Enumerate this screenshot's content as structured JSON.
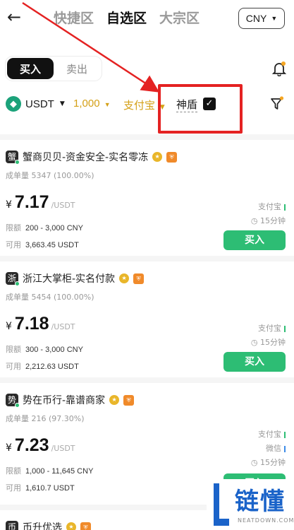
{
  "header": {
    "back_icon": "arrow-left-icon",
    "tabs": [
      {
        "label": "快捷区",
        "active": false
      },
      {
        "label": "自选区",
        "active": true
      },
      {
        "label": "大宗区",
        "active": false
      }
    ],
    "currency": "CNY"
  },
  "trade_toggle": {
    "buy": "买入",
    "sell": "出",
    "sell_prefix": "卖"
  },
  "filters": {
    "coin": "USDT",
    "amount": "1,000",
    "payment": "支付宝",
    "shield_label": "神盾",
    "shield_checked": true
  },
  "listings": [
    {
      "avatar": "蟹",
      "name": "蟹商贝贝-资金安全-实名零冻",
      "stats_label": "成单量",
      "stats": "5347 (100.00%)",
      "currency_symbol": "¥",
      "price": "7.17",
      "unit": "/USDT",
      "limit_label": "限额",
      "limit": "200 - 3,000 CNY",
      "avail_label": "可用",
      "available": "3,663.45 USDT",
      "payments": [
        "支付宝"
      ],
      "time": "15分钟",
      "action": "买入"
    },
    {
      "avatar": "浙",
      "name": "浙江大掌柜-实名付款",
      "stats_label": "成单量",
      "stats": "5454 (100.00%)",
      "currency_symbol": "¥",
      "price": "7.18",
      "unit": "/USDT",
      "limit_label": "限额",
      "limit": "300 - 3,000 CNY",
      "avail_label": "可用",
      "available": "2,212.63 USDT",
      "payments": [
        "支付宝"
      ],
      "time": "15分钟",
      "action": "买入"
    },
    {
      "avatar": "势",
      "name": "势在币行-靠谱商家",
      "stats_label": "成单量",
      "stats": "216 (97.30%)",
      "currency_symbol": "¥",
      "price": "7.23",
      "unit": "/USDT",
      "limit_label": "限额",
      "limit": "1,000 - 11,645 CNY",
      "avail_label": "可用",
      "available": "1,610.7 USDT",
      "payments": [
        "支付宝",
        "微信"
      ],
      "time": "15分钟",
      "action": "买入"
    },
    {
      "avatar": "币",
      "name": "币升优选"
    }
  ],
  "watermark": {
    "text": "链懂",
    "sub": "NEATDOWN.COM"
  },
  "colors": {
    "accent_green": "#2dbd74",
    "filter_gold": "#d4a017",
    "highlight_red": "#e42222"
  }
}
